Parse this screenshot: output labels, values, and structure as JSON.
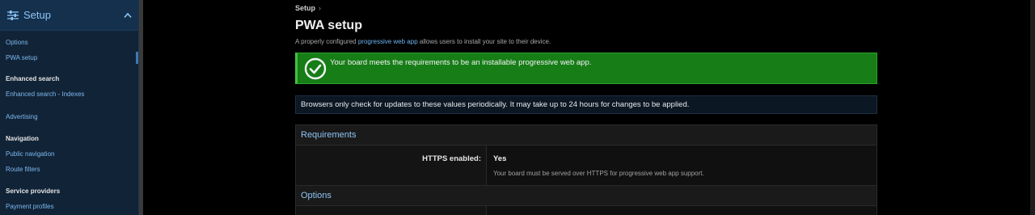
{
  "sidebar": {
    "title": "Setup",
    "header_icon": "sliders-icon",
    "collapse_icon": "chevron-up-icon",
    "items": [
      {
        "type": "link",
        "label": "Options"
      },
      {
        "type": "link",
        "label": "PWA setup",
        "active": true
      },
      {
        "type": "group",
        "label": "Enhanced search"
      },
      {
        "type": "link",
        "label": "Enhanced search - Indexes"
      },
      {
        "type": "link",
        "label": "Advertising"
      },
      {
        "type": "group",
        "label": "Navigation"
      },
      {
        "type": "link",
        "label": "Public navigation"
      },
      {
        "type": "link",
        "label": "Route filters"
      },
      {
        "type": "group",
        "label": "Service providers"
      },
      {
        "type": "link",
        "label": "Payment profiles"
      }
    ]
  },
  "breadcrumb": {
    "label": "Setup",
    "separator": "›"
  },
  "page": {
    "title": "PWA setup",
    "explain_prefix": "A properly configured ",
    "explain_link": "progressive web app",
    "explain_suffix": " allows users to install your site to their device."
  },
  "success": {
    "icon": "check-circle-icon",
    "message": "Your board meets the requirements to be an installable progressive web app."
  },
  "note": "Browsers only check for updates to these values periodically. It may take up to 24 hours for changes to be applied.",
  "requirements": {
    "heading": "Requirements",
    "rows": [
      {
        "label": "HTTPS enabled:",
        "value": "Yes",
        "hint": "Your board must be served over HTTPS for progressive web app support."
      }
    ]
  },
  "options": {
    "heading": "Options"
  },
  "colors": {
    "sidebar_bg": "#112337",
    "accent": "#8ec5f5",
    "link": "#6db4f0",
    "success_bg": "#177d17",
    "success_border": "#41c241"
  }
}
